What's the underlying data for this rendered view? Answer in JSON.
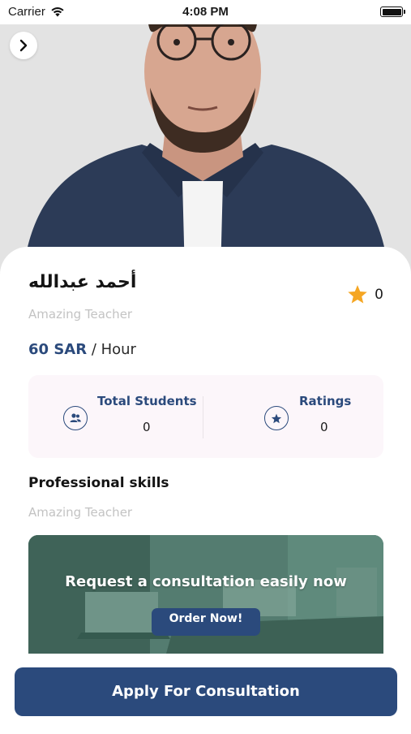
{
  "status_bar": {
    "carrier": "Carrier",
    "time": "4:08 PM"
  },
  "profile": {
    "name": "أحمد عبدالله",
    "title": "Amazing Teacher",
    "rating": "0",
    "price": "60 SAR",
    "price_unit": "/ Hour"
  },
  "stats": {
    "students_label": "Total Students",
    "students_value": "0",
    "ratings_label": "Ratings",
    "ratings_value": "0"
  },
  "skills": {
    "heading": "Professional skills",
    "text": "Amazing Teacher"
  },
  "banner": {
    "title": "Request a consultation easily now",
    "button": "Order Now!"
  },
  "cta": {
    "label": "Apply For Consultation"
  },
  "colors": {
    "primary": "#2b4a7c",
    "star": "#f5a623",
    "stats_bg": "#fcf6fa"
  },
  "icons": [
    "wifi-icon",
    "battery-icon",
    "chevron-right-icon",
    "star-icon",
    "users-icon",
    "star-circle-icon"
  ]
}
